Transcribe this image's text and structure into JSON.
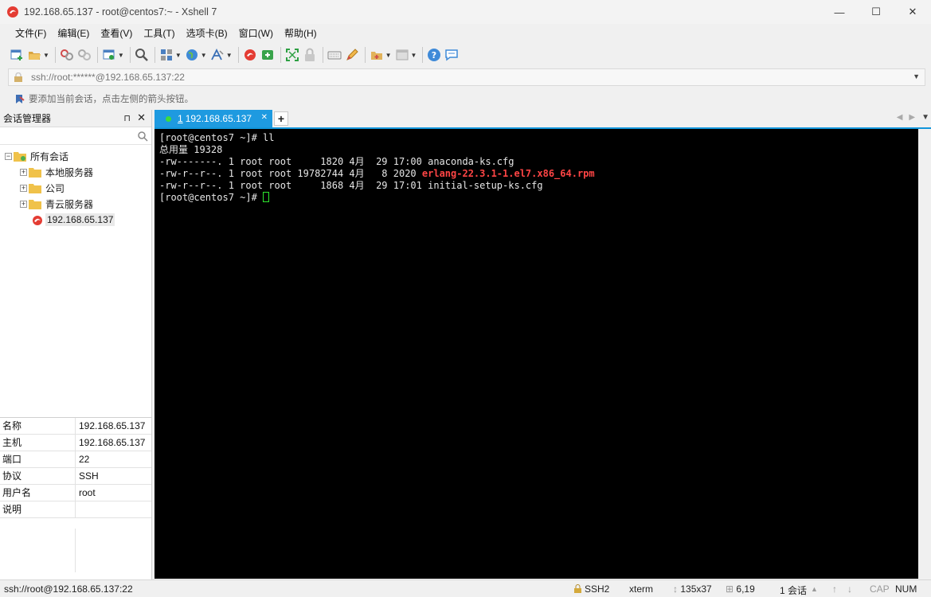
{
  "window": {
    "title": "192.168.65.137 - root@centos7:~ - Xshell 7",
    "minimize": "—",
    "maximize": "☐",
    "close": "✕"
  },
  "menu": [
    "文件(F)",
    "编辑(E)",
    "查看(V)",
    "工具(T)",
    "选项卡(B)",
    "窗口(W)",
    "帮助(H)"
  ],
  "address": {
    "value": "ssh://root:******@192.168.65.137:22"
  },
  "tip": "要添加当前会话，点击左侧的箭头按钮。",
  "session_manager": {
    "title": "会话管理器",
    "pin": "⊓",
    "close": "✕",
    "tree": {
      "root": "所有会话",
      "folders": [
        "本地服务器",
        "公司",
        "青云服务器"
      ],
      "session": "192.168.65.137"
    },
    "properties": [
      {
        "key": "名称",
        "value": "192.168.65.137"
      },
      {
        "key": "主机",
        "value": "192.168.65.137"
      },
      {
        "key": "端口",
        "value": "22"
      },
      {
        "key": "协议",
        "value": "SSH"
      },
      {
        "key": "用户名",
        "value": "root"
      },
      {
        "key": "说明",
        "value": ""
      }
    ]
  },
  "tabs": {
    "active": {
      "number": "1",
      "label": "192.168.65.137"
    },
    "add": "+"
  },
  "terminal": {
    "lines": [
      "[root@centos7 ~]# ll",
      "总用量 19328",
      "-rw-------. 1 root root     1820 4月  29 17:00 anaconda-ks.cfg"
    ],
    "line4_prefix": "-rw-r--r--. 1 root root 19782744 4月   8 2020 ",
    "line4_highlight": "erlang-22.3.1-1.el7.x86_64.rpm",
    "line5": "-rw-r--r--. 1 root root     1868 4月  29 17:01 initial-setup-ks.cfg",
    "prompt": "[root@centos7 ~]# ",
    "colors": {
      "background": "#000000",
      "text": "#e6e6e6",
      "highlight": "#ff4545",
      "cursor": "#2ee82e"
    }
  },
  "status": {
    "connection": "ssh://root@192.168.65.137:22",
    "protocol": "SSH2",
    "terminal_type": "xterm",
    "size": "135x37",
    "cursor_pos": "6,19",
    "sessions": "1 会话",
    "cap": "CAP",
    "num": "NUM"
  },
  "accent_color": "#1e9ae0"
}
